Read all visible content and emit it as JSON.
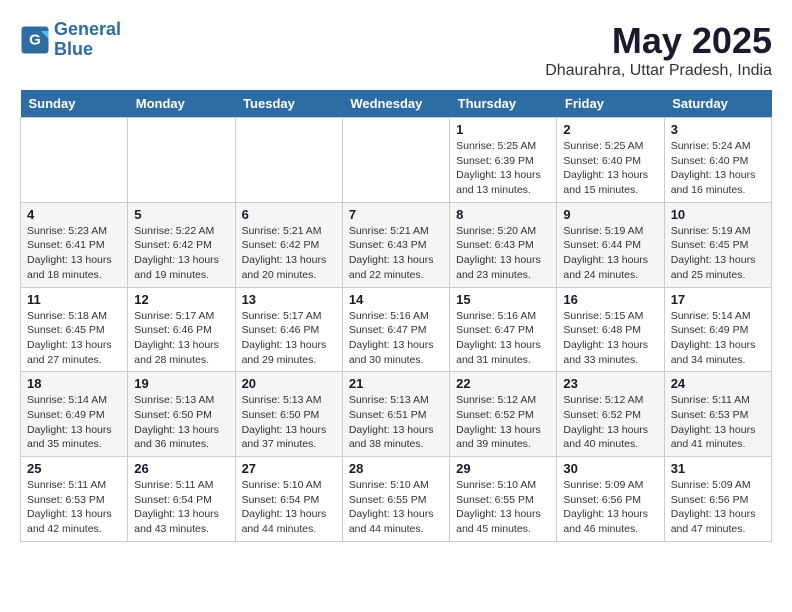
{
  "header": {
    "logo_line1": "General",
    "logo_line2": "Blue",
    "month": "May 2025",
    "location": "Dhaurahra, Uttar Pradesh, India"
  },
  "weekdays": [
    "Sunday",
    "Monday",
    "Tuesday",
    "Wednesday",
    "Thursday",
    "Friday",
    "Saturday"
  ],
  "weeks": [
    [
      {
        "day": "",
        "info": ""
      },
      {
        "day": "",
        "info": ""
      },
      {
        "day": "",
        "info": ""
      },
      {
        "day": "",
        "info": ""
      },
      {
        "day": "1",
        "info": "Sunrise: 5:25 AM\nSunset: 6:39 PM\nDaylight: 13 hours\nand 13 minutes."
      },
      {
        "day": "2",
        "info": "Sunrise: 5:25 AM\nSunset: 6:40 PM\nDaylight: 13 hours\nand 15 minutes."
      },
      {
        "day": "3",
        "info": "Sunrise: 5:24 AM\nSunset: 6:40 PM\nDaylight: 13 hours\nand 16 minutes."
      }
    ],
    [
      {
        "day": "4",
        "info": "Sunrise: 5:23 AM\nSunset: 6:41 PM\nDaylight: 13 hours\nand 18 minutes."
      },
      {
        "day": "5",
        "info": "Sunrise: 5:22 AM\nSunset: 6:42 PM\nDaylight: 13 hours\nand 19 minutes."
      },
      {
        "day": "6",
        "info": "Sunrise: 5:21 AM\nSunset: 6:42 PM\nDaylight: 13 hours\nand 20 minutes."
      },
      {
        "day": "7",
        "info": "Sunrise: 5:21 AM\nSunset: 6:43 PM\nDaylight: 13 hours\nand 22 minutes."
      },
      {
        "day": "8",
        "info": "Sunrise: 5:20 AM\nSunset: 6:43 PM\nDaylight: 13 hours\nand 23 minutes."
      },
      {
        "day": "9",
        "info": "Sunrise: 5:19 AM\nSunset: 6:44 PM\nDaylight: 13 hours\nand 24 minutes."
      },
      {
        "day": "10",
        "info": "Sunrise: 5:19 AM\nSunset: 6:45 PM\nDaylight: 13 hours\nand 25 minutes."
      }
    ],
    [
      {
        "day": "11",
        "info": "Sunrise: 5:18 AM\nSunset: 6:45 PM\nDaylight: 13 hours\nand 27 minutes."
      },
      {
        "day": "12",
        "info": "Sunrise: 5:17 AM\nSunset: 6:46 PM\nDaylight: 13 hours\nand 28 minutes."
      },
      {
        "day": "13",
        "info": "Sunrise: 5:17 AM\nSunset: 6:46 PM\nDaylight: 13 hours\nand 29 minutes."
      },
      {
        "day": "14",
        "info": "Sunrise: 5:16 AM\nSunset: 6:47 PM\nDaylight: 13 hours\nand 30 minutes."
      },
      {
        "day": "15",
        "info": "Sunrise: 5:16 AM\nSunset: 6:47 PM\nDaylight: 13 hours\nand 31 minutes."
      },
      {
        "day": "16",
        "info": "Sunrise: 5:15 AM\nSunset: 6:48 PM\nDaylight: 13 hours\nand 33 minutes."
      },
      {
        "day": "17",
        "info": "Sunrise: 5:14 AM\nSunset: 6:49 PM\nDaylight: 13 hours\nand 34 minutes."
      }
    ],
    [
      {
        "day": "18",
        "info": "Sunrise: 5:14 AM\nSunset: 6:49 PM\nDaylight: 13 hours\nand 35 minutes."
      },
      {
        "day": "19",
        "info": "Sunrise: 5:13 AM\nSunset: 6:50 PM\nDaylight: 13 hours\nand 36 minutes."
      },
      {
        "day": "20",
        "info": "Sunrise: 5:13 AM\nSunset: 6:50 PM\nDaylight: 13 hours\nand 37 minutes."
      },
      {
        "day": "21",
        "info": "Sunrise: 5:13 AM\nSunset: 6:51 PM\nDaylight: 13 hours\nand 38 minutes."
      },
      {
        "day": "22",
        "info": "Sunrise: 5:12 AM\nSunset: 6:52 PM\nDaylight: 13 hours\nand 39 minutes."
      },
      {
        "day": "23",
        "info": "Sunrise: 5:12 AM\nSunset: 6:52 PM\nDaylight: 13 hours\nand 40 minutes."
      },
      {
        "day": "24",
        "info": "Sunrise: 5:11 AM\nSunset: 6:53 PM\nDaylight: 13 hours\nand 41 minutes."
      }
    ],
    [
      {
        "day": "25",
        "info": "Sunrise: 5:11 AM\nSunset: 6:53 PM\nDaylight: 13 hours\nand 42 minutes."
      },
      {
        "day": "26",
        "info": "Sunrise: 5:11 AM\nSunset: 6:54 PM\nDaylight: 13 hours\nand 43 minutes."
      },
      {
        "day": "27",
        "info": "Sunrise: 5:10 AM\nSunset: 6:54 PM\nDaylight: 13 hours\nand 44 minutes."
      },
      {
        "day": "28",
        "info": "Sunrise: 5:10 AM\nSunset: 6:55 PM\nDaylight: 13 hours\nand 44 minutes."
      },
      {
        "day": "29",
        "info": "Sunrise: 5:10 AM\nSunset: 6:55 PM\nDaylight: 13 hours\nand 45 minutes."
      },
      {
        "day": "30",
        "info": "Sunrise: 5:09 AM\nSunset: 6:56 PM\nDaylight: 13 hours\nand 46 minutes."
      },
      {
        "day": "31",
        "info": "Sunrise: 5:09 AM\nSunset: 6:56 PM\nDaylight: 13 hours\nand 47 minutes."
      }
    ]
  ]
}
